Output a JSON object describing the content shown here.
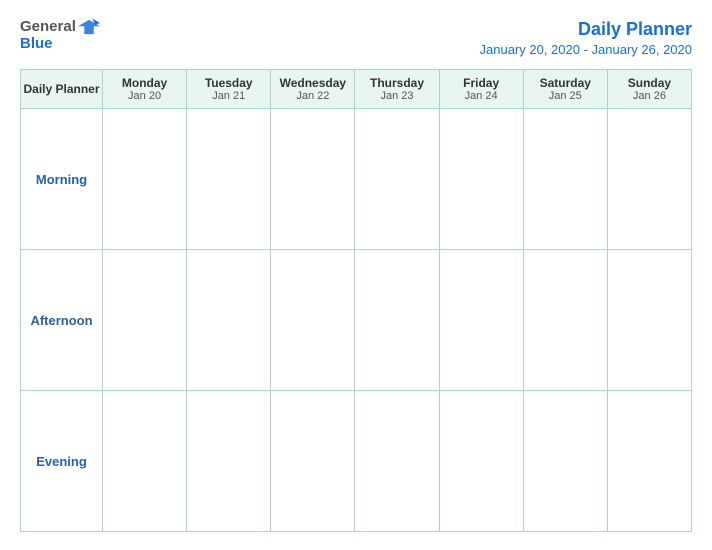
{
  "header": {
    "logo_general": "General",
    "logo_blue": "Blue",
    "title": "Daily Planner",
    "date_range": "January 20, 2020 - January 26, 2020"
  },
  "table": {
    "first_col_label": "Daily Planner",
    "days": [
      {
        "name": "Monday",
        "date": "Jan 20"
      },
      {
        "name": "Tuesday",
        "date": "Jan 21"
      },
      {
        "name": "Wednesday",
        "date": "Jan 22"
      },
      {
        "name": "Thursday",
        "date": "Jan 23"
      },
      {
        "name": "Friday",
        "date": "Jan 24"
      },
      {
        "name": "Saturday",
        "date": "Jan 25"
      },
      {
        "name": "Sunday",
        "date": "Jan 26"
      }
    ],
    "time_slots": [
      {
        "label": "Morning"
      },
      {
        "label": "Afternoon"
      },
      {
        "label": "Evening"
      }
    ]
  }
}
